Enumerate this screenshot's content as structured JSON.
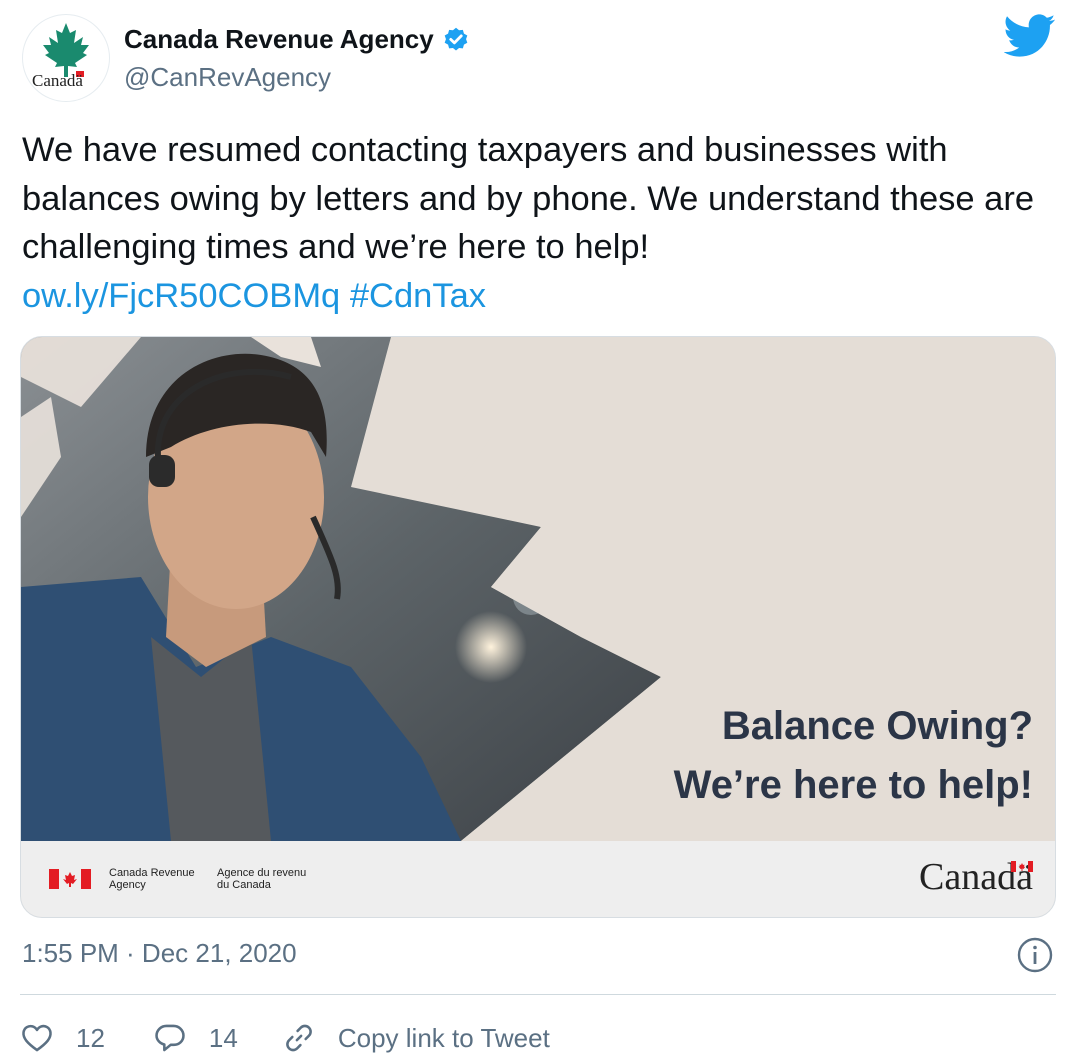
{
  "author": {
    "display_name": "Canada Revenue Agency",
    "handle": "@CanRevAgency",
    "avatar_wordmark": "Canadä",
    "verified": true
  },
  "tweet": {
    "text": "We have resumed contacting taxpayers and businesses with balances owing by letters and by phone. We understand these are challenging times and we’re here to help!",
    "link": "ow.ly/FjcR50COBMq",
    "hashtag": "#CdnTax",
    "timestamp": "1:55 PM · Dec 21, 2020"
  },
  "card": {
    "headline_line1": "Balance Owing?",
    "headline_line2": "We’re here to help!",
    "agency_en_line1": "Canada Revenue",
    "agency_en_line2": "Agency",
    "agency_fr_line1": "Agence du revenu",
    "agency_fr_line2": "du Canada",
    "wordmark": "Canadä"
  },
  "actions": {
    "like_count": "12",
    "reply_count": "14",
    "copy_link_label": "Copy link to Tweet"
  },
  "colors": {
    "link": "#1b95e0",
    "secondary_text": "#5b7083",
    "twitter_blue": "#1da1f2",
    "headline": "#2b3547",
    "card_background": "#e4ddd6",
    "canada_red": "#e31c23"
  },
  "icons": [
    "maple-leaf-logo",
    "verified-badge-icon",
    "twitter-bird-icon",
    "info-icon",
    "heart-icon",
    "reply-bubble-icon",
    "link-icon",
    "canada-flag-icon"
  ]
}
